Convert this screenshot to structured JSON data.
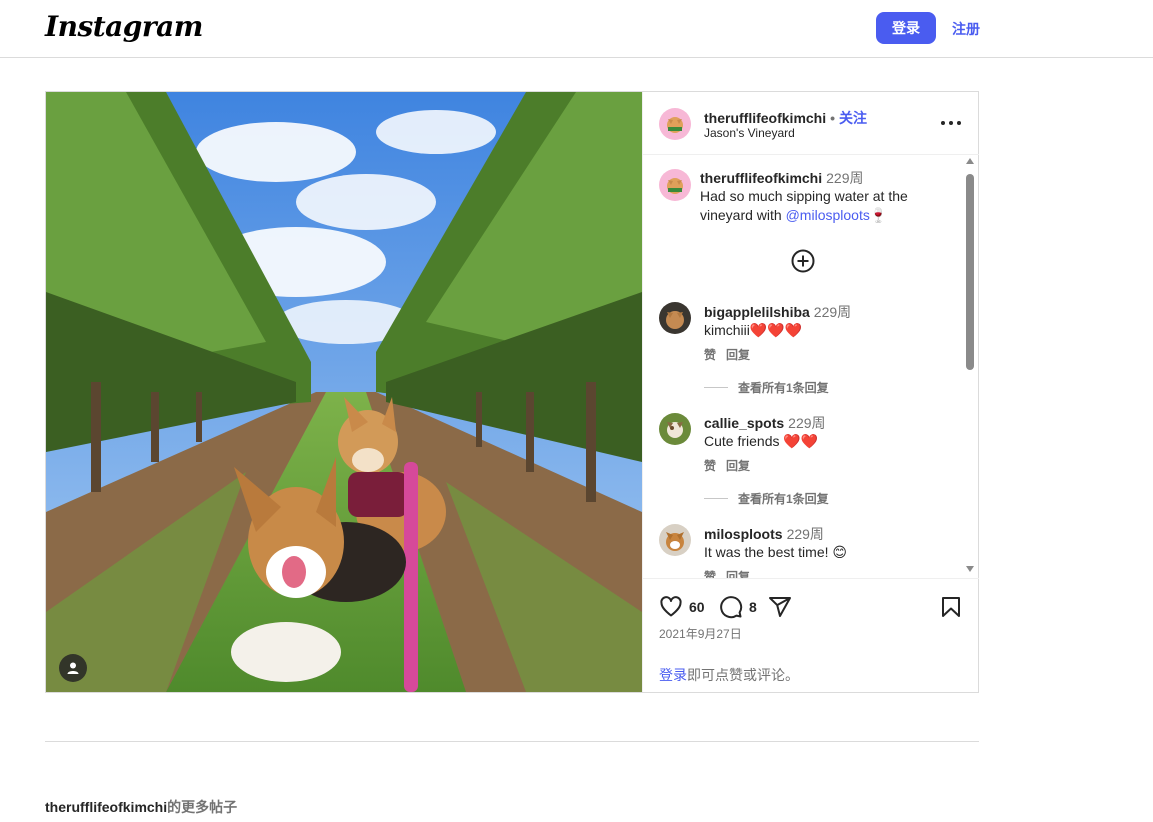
{
  "header": {
    "logo_text": "Instagram",
    "login_label": "登录",
    "signup_label": "注册"
  },
  "post": {
    "username": "therufflifeofkimchi",
    "dot": "•",
    "follow_label": "关注",
    "location": "Jason's Vineyard",
    "caption": {
      "time": "229周",
      "text_before": "Had so much sipping water at the vineyard with ",
      "mention": "@milosploots",
      "emoji": "🍷"
    },
    "likes": "60",
    "comments_count": "8",
    "date": "2021年9月27日",
    "login_link": "登录",
    "login_hint_rest": "即可点赞或评论。"
  },
  "comments": [
    {
      "user": "bigapplelilshiba",
      "time": "229周",
      "text": "kimchiii❤️❤️❤️",
      "like_label": "赞",
      "reply_label": "回复",
      "view_replies": "查看所有1条回复"
    },
    {
      "user": "callie_spots",
      "time": "229周",
      "text": "Cute friends ❤️❤️",
      "like_label": "赞",
      "reply_label": "回复",
      "view_replies": "查看所有1条回复"
    },
    {
      "user": "milosploots",
      "time": "229周",
      "text": "It was the best time! 😊",
      "like_label": "赞",
      "reply_label": "回复"
    }
  ],
  "more_posts": {
    "user": "therufflifeofkimchi",
    "suffix": "的更多帖子"
  },
  "colors": {
    "accent": "#4a5cf0",
    "text": "#262626",
    "muted": "#737373",
    "border": "#dbdbdb"
  },
  "icons": [
    "heart-icon",
    "comment-icon",
    "share-icon",
    "bookmark-icon",
    "add-circle-icon",
    "more-options-icon",
    "tagged-user-icon"
  ]
}
